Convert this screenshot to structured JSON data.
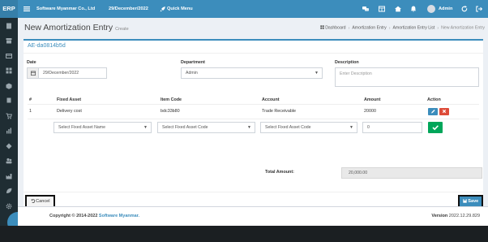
{
  "topbar": {
    "brand": "ERP",
    "company": "Software Myanmar Co., Ltd",
    "date": "29/December/2022",
    "quick_menu": "Quick Menu",
    "user": "Admin"
  },
  "page": {
    "title": "New Amortization Entry",
    "subtitle": "Create",
    "breadcrumb": [
      "Dashboard",
      "Amortization Entry",
      "Amortization Entry List",
      "New Amortization Entry"
    ]
  },
  "form": {
    "reference": "AE-da0814b5d",
    "date_label": "Date",
    "date_value": "29/December/2022",
    "department_label": "Department",
    "department_value": "Admin",
    "description_label": "Description",
    "description_placeholder": "Enter Description"
  },
  "table": {
    "headers": [
      "#",
      "Fixed Asset",
      "Item Code",
      "Account",
      "Amount",
      "Action"
    ],
    "rows": [
      {
        "no": "1",
        "fixed_asset": "Delivery cost",
        "item_code": "bdc33b80",
        "account": "Trade Receivable",
        "amount": "20000"
      }
    ],
    "new_row": {
      "fixed_asset_placeholder": "Select Fixed Asset Name",
      "item_code_placeholder": "Select Fixed Asset Code",
      "account_placeholder": "Select Fixed Asset Code",
      "amount_value": "0"
    }
  },
  "total": {
    "label": "Total Amount:",
    "value": "20,000.00"
  },
  "buttons": {
    "cancel": "Cancel",
    "save": "Save"
  },
  "footer": {
    "copyright_prefix": "Copyright © 2014-2022",
    "company_link": "Software Myanmar.",
    "version_label": "Version",
    "version_value": "2022.12.29.829"
  },
  "colors": {
    "primary": "#3c8dbc",
    "danger": "#dd4b39",
    "success": "#00a65a",
    "sidebar": "#1f2d33"
  }
}
